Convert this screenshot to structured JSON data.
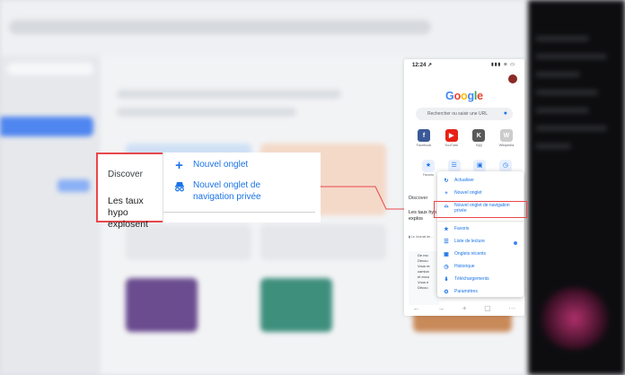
{
  "zoom_callout": {
    "discover_label": "Discover",
    "headline": "Les taux hypo explosent",
    "menu_items": [
      {
        "icon": "plus-icon",
        "label": "Nouvel onglet"
      },
      {
        "icon": "incognito-icon",
        "label": "Nouvel onglet de navigation privée"
      }
    ]
  },
  "phone": {
    "status": {
      "time": "12:24 ↗",
      "icons": "▮▮▮ ≋ ▭"
    },
    "logo_letters": [
      {
        "ch": "G",
        "color": "#4285f4"
      },
      {
        "ch": "o",
        "color": "#ea4335"
      },
      {
        "ch": "o",
        "color": "#fbbc05"
      },
      {
        "ch": "g",
        "color": "#4285f4"
      },
      {
        "ch": "l",
        "color": "#34a853"
      },
      {
        "ch": "e",
        "color": "#ea4335"
      }
    ],
    "search_placeholder": "Rechercher ou saisir une URL",
    "shortcuts": [
      {
        "glyph": "f",
        "color": "#3b5998",
        "label": "Facebook"
      },
      {
        "glyph": "▶",
        "color": "#e62117",
        "label": "YouTube"
      },
      {
        "glyph": "K",
        "color": "#5a5a5a",
        "label": "Kijiji"
      },
      {
        "glyph": "W",
        "color": "#cccccc",
        "label": "Wikipedia"
      }
    ],
    "bottom_tiles": [
      {
        "glyph": "★",
        "label": "Favoris"
      },
      {
        "glyph": "☰",
        "label": ""
      },
      {
        "glyph": "▣",
        "label": ""
      },
      {
        "glyph": "◷",
        "label": ""
      }
    ],
    "discover_label": "Discover",
    "headline": "Les taux hyp explos",
    "source": "▮ Le Journal de...",
    "card_text": "De mo\nDécou\nVous re\ncamion\net envo\nVous e\nDécou"
  },
  "phone_menu": {
    "items": [
      {
        "icon": "refresh-icon",
        "label": "Actualiser"
      },
      {
        "icon": "plus-icon",
        "label": "Nouvel onglet"
      },
      {
        "icon": "incognito-icon",
        "label": "Nouvel onglet de navigation privée"
      },
      {
        "icon": "star-icon",
        "label": "Favoris"
      },
      {
        "icon": "reading-list-icon",
        "label": "Liste de lecture"
      },
      {
        "icon": "recent-tabs-icon",
        "label": "Onglets récents"
      },
      {
        "icon": "history-icon",
        "label": "Historique"
      },
      {
        "icon": "download-icon",
        "label": "Téléchargements"
      },
      {
        "icon": "gear-icon",
        "label": "Paramètres"
      }
    ]
  },
  "colors": {
    "accent": "#1a73e8",
    "highlight": "#e8474c"
  }
}
